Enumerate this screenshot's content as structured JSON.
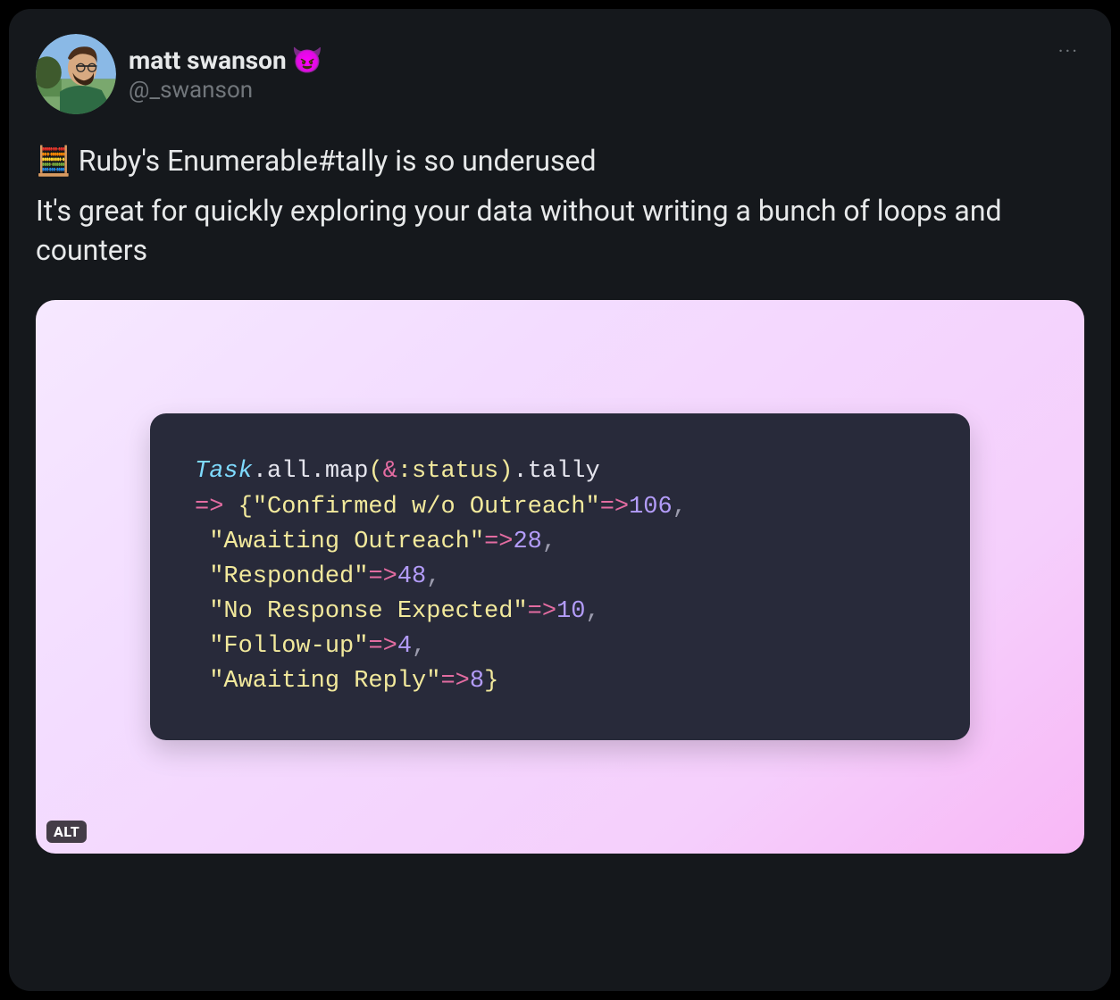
{
  "user": {
    "display_name": "matt swanson",
    "name_emoji": "😈",
    "handle": "@_swanson"
  },
  "tweet": {
    "line1_emoji": "🧮",
    "line1_text": " Ruby's Enumerable#tally is so underused",
    "line2_text": "It's great for quickly exploring your data without writing a bunch of loops and counters"
  },
  "code": {
    "class": "Task",
    "m1": ".all.map",
    "amp": "&",
    "sym": ":status",
    "m2": ".tally",
    "arrow": "=>",
    "open_brace": "{",
    "close_brace": "}",
    "fat": "=>",
    "entries": [
      {
        "key": "\"Confirmed w/o Outreach\"",
        "val": "106",
        "trail": ","
      },
      {
        "key": "\"Awaiting Outreach\"",
        "val": "28",
        "trail": ","
      },
      {
        "key": "\"Responded\"",
        "val": "48",
        "trail": ","
      },
      {
        "key": "\"No Response Expected\"",
        "val": "10",
        "trail": ","
      },
      {
        "key": "\"Follow-up\"",
        "val": "4",
        "trail": ","
      },
      {
        "key": "\"Awaiting Reply\"",
        "val": "8",
        "trail": ""
      }
    ]
  },
  "alt_label": "ALT",
  "more_label": "···"
}
